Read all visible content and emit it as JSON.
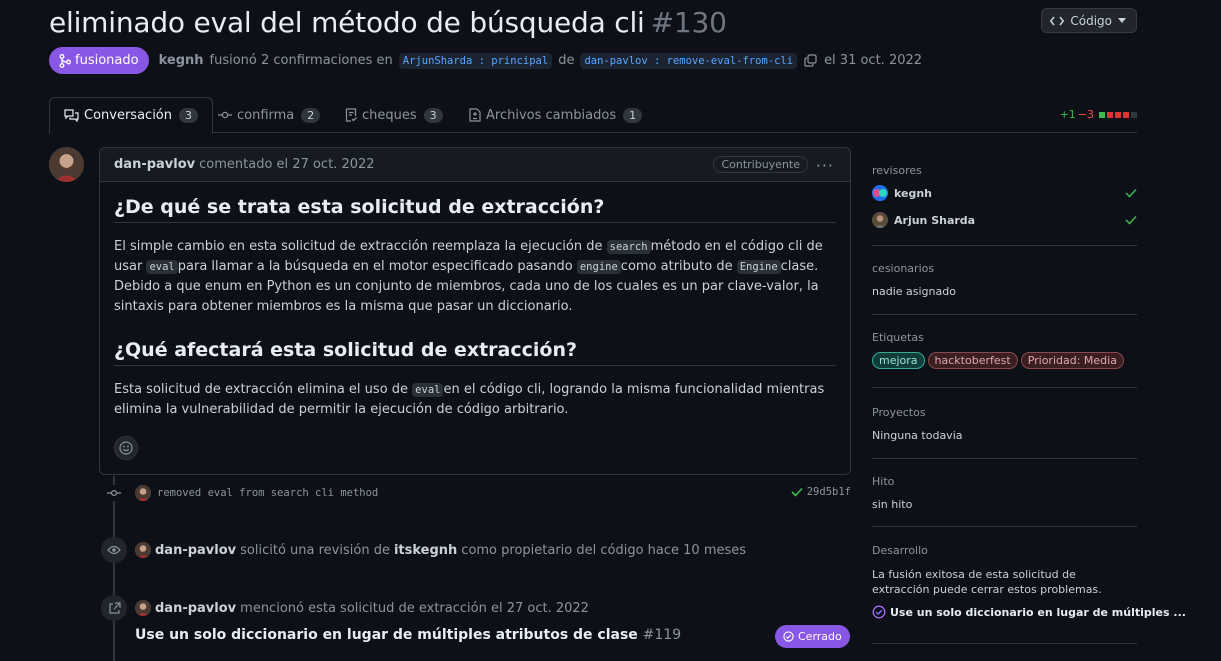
{
  "header": {
    "title": "eliminado eval del método de búsqueda cli",
    "number": "#130",
    "code_button": "Código"
  },
  "meta": {
    "status_badge": "fusionado",
    "author": "kegnh",
    "action": "fusionó 2 confirmaciones en",
    "base_branch": "ArjunSharda : principal",
    "from_word": "de",
    "head_branch": "dan-pavlov : remove-eval-from-cli",
    "date": "el 31 oct. 2022"
  },
  "tabs": [
    {
      "label": "Conversación",
      "count": "3"
    },
    {
      "label": "confirma",
      "count": "2"
    },
    {
      "label": "cheques",
      "count": "3"
    },
    {
      "label": "Archivos cambiados",
      "count": "1"
    }
  ],
  "diffstat": {
    "additions": "+1",
    "deletions": "−3"
  },
  "comment": {
    "author": "dan-pavlov",
    "time": "comentado el 27 oct. 2022",
    "role_badge": "Contribuyente",
    "heading1": "¿De qué se trata esta solicitud de extracción?",
    "p1": {
      "t1": "El simple cambio en esta solicitud de extracción reemplaza la ejecución de",
      "c1": "search",
      "t2": "método en el código cli de usar",
      "c2": "eval",
      "t3": "para llamar a la búsqueda en el motor especificado pasando",
      "c3": "engine",
      "t4": "como atributo de",
      "c4": "Engine",
      "t5": "clase. Debido a que enum en Python es un conjunto de miembros, cada uno de los cuales es un par clave-valor, la sintaxis para obtener miembros es la misma que pasar un diccionario."
    },
    "heading2": "¿Qué afectará esta solicitud de extracción?",
    "p2": {
      "t1": "Esta solicitud de extracción elimina el uso de",
      "c1": "eval",
      "t2": "en el código cli, logrando la misma funcionalidad mientras elimina la vulnerabilidad de permitir la ejecución de código arbitrario."
    }
  },
  "timeline": {
    "commit_message": "removed eval from search cli method",
    "commit_sha": "29d5b1f",
    "review_event": {
      "actor": "dan-pavlov",
      "text": "solicitó una revisión de",
      "target": "itskegnh",
      "suffix": "como propietario del código hace 10 meses"
    },
    "mention_event": {
      "actor": "dan-pavlov",
      "text": "mencionó esta solicitud de extracción el 27 oct. 2022"
    },
    "linked_issue": {
      "title": "Use un solo diccionario en lugar de múltiples atributos de clase",
      "number": "#119",
      "state": "Cerrado"
    }
  },
  "sidebar": {
    "reviewers_title": "revisores",
    "reviewers": [
      {
        "name": "kegnh"
      },
      {
        "name": "Arjun Sharda"
      }
    ],
    "assignees_title": "cesionarios",
    "assignees_value": "nadie asignado",
    "labels_title": "Etiquetas",
    "labels": [
      "mejora",
      "hacktoberfest",
      "Prioridad: Media"
    ],
    "projects_title": "Proyectos",
    "projects_value": "Ninguna todavia",
    "milestone_title": "Hito",
    "milestone_value": "sin hito",
    "development_title": "Desarrollo",
    "development_text": "La fusión exitosa de esta solicitud de extracción puede cerrar estos problemas.",
    "development_link": "Use un solo diccionario en lugar de múltiples ..."
  },
  "colors": {
    "background": "#0d1117",
    "merged_purple": "#8957e5",
    "link_blue": "#58a6ff",
    "success_green": "#3fb950",
    "danger_red": "#f85149"
  }
}
